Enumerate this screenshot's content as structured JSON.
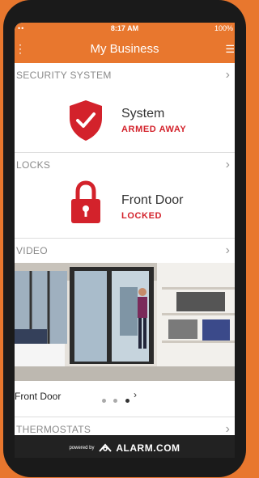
{
  "statusbar": {
    "signal": "••",
    "time": "8:17 AM",
    "battery": "100%"
  },
  "appbar": {
    "title": "My Business"
  },
  "security": {
    "header": "SECURITY SYSTEM",
    "title": "System",
    "status": "ARMED AWAY"
  },
  "locks": {
    "header": "LOCKS",
    "title": "Front Door",
    "status": "LOCKED"
  },
  "video": {
    "header": "VIDEO",
    "label": "Front Door",
    "pages": 3,
    "active_page": 3
  },
  "thermostats": {
    "header": "THERMOSTATS"
  },
  "footer": {
    "powered_by": "powered by",
    "brand": "ALARM.COM"
  },
  "colors": {
    "brand_orange": "#e8772e",
    "alert_red": "#d3222b"
  }
}
